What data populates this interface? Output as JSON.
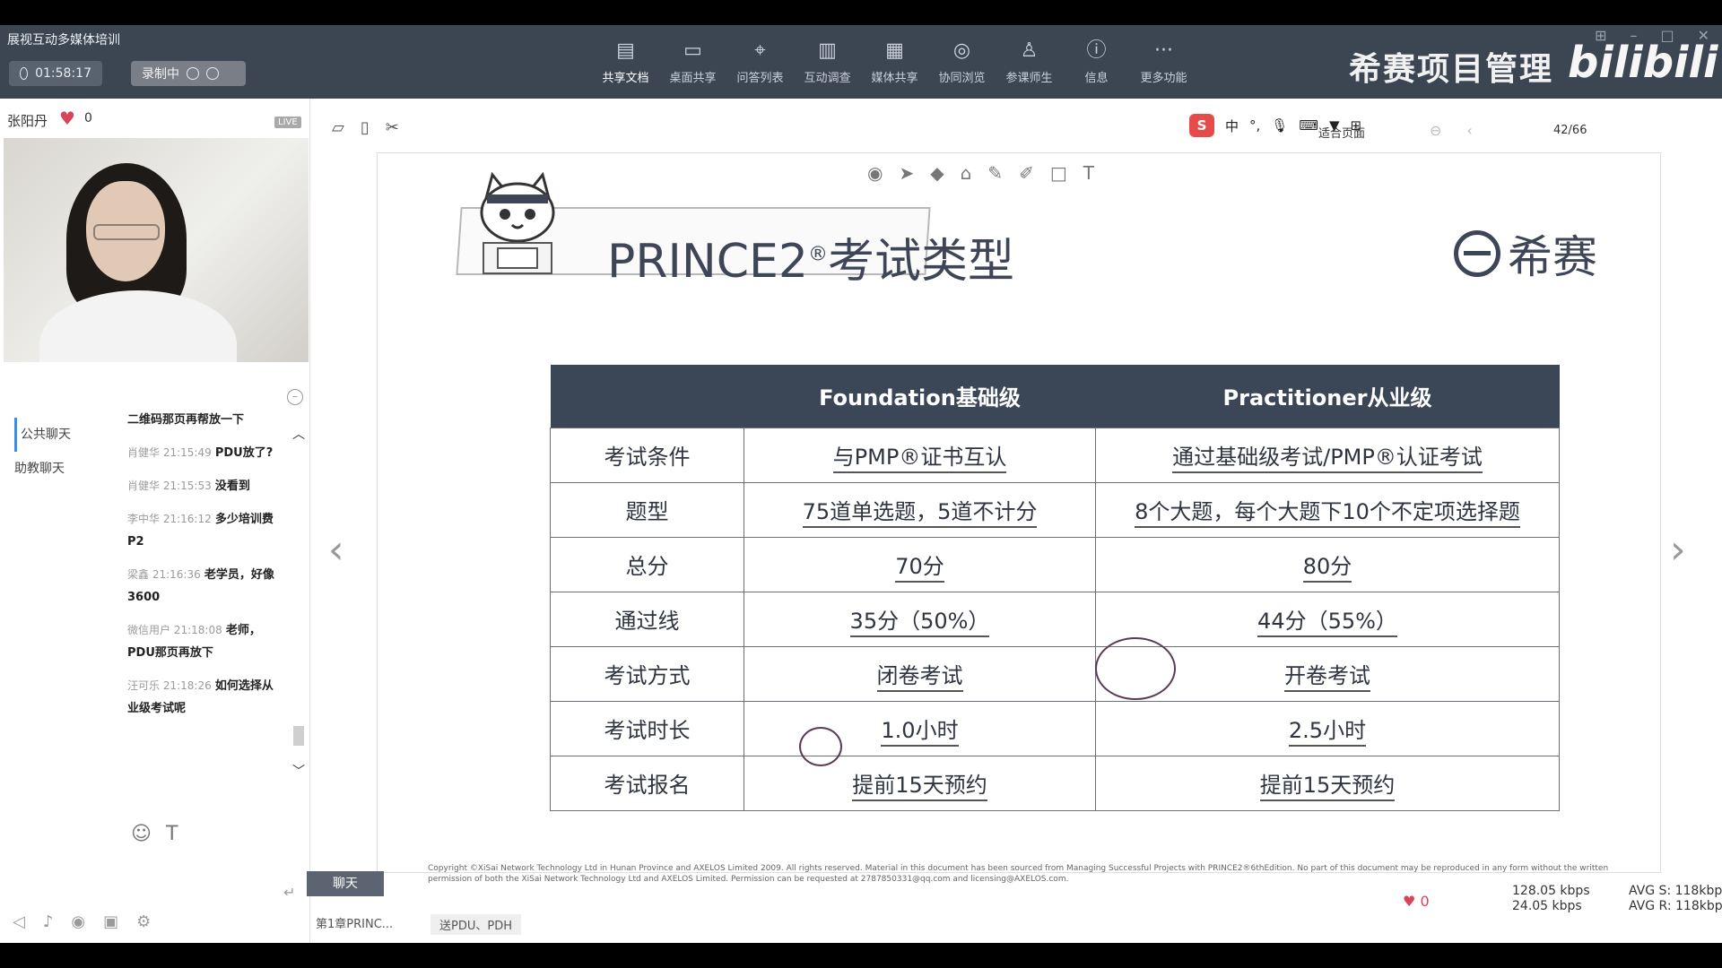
{
  "window": {
    "title": "展视互动多媒体培训",
    "timer": "01:58:17",
    "recording": "录制中"
  },
  "toolbar": [
    {
      "label": "共享文档",
      "icon": "document-icon",
      "glyph": "▤"
    },
    {
      "label": "桌面共享",
      "icon": "desktop-icon",
      "glyph": "▭"
    },
    {
      "label": "问答列表",
      "icon": "qa-icon",
      "glyph": "⌖"
    },
    {
      "label": "互动调查",
      "icon": "survey-icon",
      "glyph": "▥"
    },
    {
      "label": "媒体共享",
      "icon": "media-icon",
      "glyph": "▦"
    },
    {
      "label": "协同浏览",
      "icon": "compass-icon",
      "glyph": "◎"
    },
    {
      "label": "参课师生",
      "icon": "users-icon",
      "glyph": "♙"
    },
    {
      "label": "信息",
      "icon": "info-icon",
      "glyph": "ⓘ"
    },
    {
      "label": "更多功能",
      "icon": "more-icon",
      "glyph": "···"
    }
  ],
  "brand": {
    "text": "希赛项目管理",
    "watermark": "bilibili"
  },
  "host": {
    "name": "张阳丹",
    "likes": "0",
    "live_badge": "LIVE"
  },
  "chat": {
    "tabs": [
      "公共聊天",
      "助教聊天"
    ],
    "messages": [
      {
        "meta": "",
        "text": "二维码那页再帮放一下"
      },
      {
        "meta": "肖健华 21:15:49",
        "text": "PDU放了?"
      },
      {
        "meta": "肖健华 21:15:53",
        "text": "没看到"
      },
      {
        "meta": "李中华 21:16:12",
        "text": "多少培训费P2"
      },
      {
        "meta": "梁鑫 21:16:36",
        "text": "老学员，好像3600"
      },
      {
        "meta": "微信用户 21:18:08",
        "text": "老师，PDU那页再放下"
      },
      {
        "meta": "汪可乐 21:18:26",
        "text": "如何选择从业级考试呢"
      }
    ]
  },
  "ime": {
    "logo": "S",
    "lang": "中"
  },
  "viewer": {
    "fit": "适合页面",
    "page": "42/66"
  },
  "slide": {
    "title": "PRINCE2",
    "title_sup": "®",
    "title_suffix": "考试类型",
    "logo_text": "希赛",
    "header": {
      "col1": "",
      "col2": "Foundation基础级",
      "col3": "Practitioner从业级"
    },
    "rows": [
      {
        "label": "考试条件",
        "foundation": "与PMP®证书互认",
        "practitioner": "通过基础级考试/PMP®认证考试"
      },
      {
        "label": "题型",
        "foundation": "75道单选题，5道不计分",
        "practitioner": "8个大题，每个大题下10个不定项选择题"
      },
      {
        "label": "总分",
        "foundation": "70分",
        "practitioner": "80分"
      },
      {
        "label": "通过线",
        "foundation": "35分（50%）",
        "practitioner": "44分（55%）"
      },
      {
        "label": "考试方式",
        "foundation": "闭卷考试",
        "practitioner": "开卷考试"
      },
      {
        "label": "考试时长",
        "foundation": "1.0小时",
        "practitioner": "2.5小时"
      },
      {
        "label": "考试报名",
        "foundation": "提前15天预约",
        "practitioner": "提前15天预约"
      }
    ],
    "copyright": "Copyright ©XiSai Network Technology Ltd in Hunan Province and AXELOS Limited 2009. All rights reserved. Material in this document has been sourced from Managing Successful Projects with PRINCE2®6thEdition. No part of this document may be reproduced in any form without the written permission of both the XiSai Network Technology Ltd and AXELOS Limited. Permission can be requested at 2787850331@qq.com and licensing@AXELOS.com."
  },
  "status": {
    "crumb1": "第1章PRINC...",
    "crumb2": "送PDU、PDH",
    "chat_button": "聊天",
    "likes": "0",
    "up_rate": "128.05 kbps",
    "down_rate": "24.05 kbps",
    "avg_s": "AVG S: 118kbps",
    "avg_r": "AVG R: 118kbps"
  }
}
